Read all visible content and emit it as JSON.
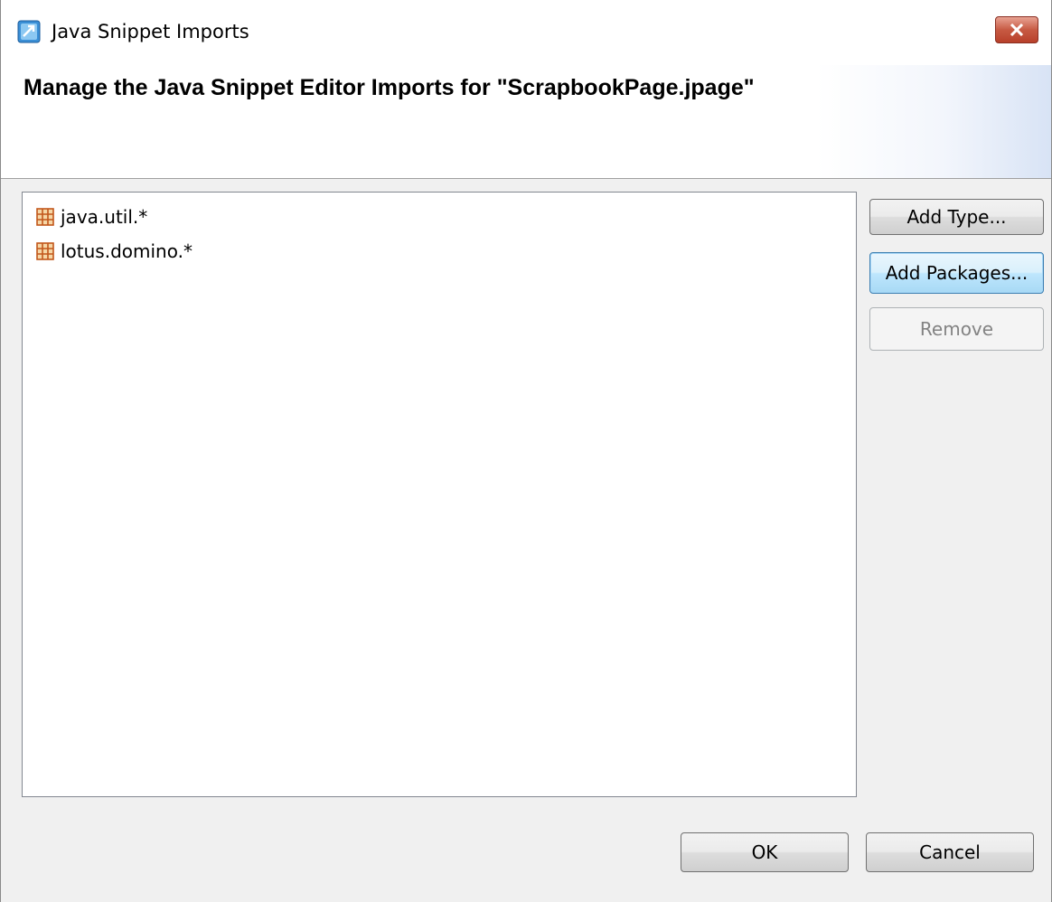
{
  "window": {
    "title": "Java Snippet Imports",
    "close_icon": "close-icon",
    "app_icon": "eclipse-dialog-icon"
  },
  "banner": {
    "title": "Manage the Java Snippet Editor Imports for \"ScrapbookPage.jpage\""
  },
  "imports": [
    {
      "label": "java.util.*",
      "icon": "package-icon"
    },
    {
      "label": "lotus.domino.*",
      "icon": "package-icon"
    }
  ],
  "side_buttons": {
    "add_type": "Add Type...",
    "add_packages": "Add Packages...",
    "remove": "Remove"
  },
  "footer": {
    "ok": "OK",
    "cancel": "Cancel"
  },
  "colors": {
    "close_button": "#c75a43",
    "package_icon": "#c2571a"
  }
}
